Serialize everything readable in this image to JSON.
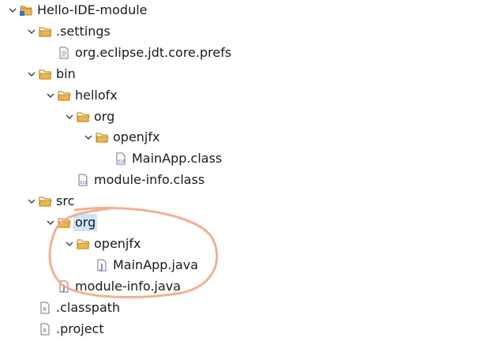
{
  "explorer": {
    "items": [
      {
        "label": "Hello-IDE-module",
        "icon": "project-icon",
        "depth": 0,
        "expanded": true
      },
      {
        "label": ".settings",
        "icon": "folder-icon",
        "depth": 1,
        "expanded": true
      },
      {
        "label": "org.eclipse.jdt.core.prefs",
        "icon": "file-icon",
        "depth": 2
      },
      {
        "label": "bin",
        "icon": "folder-icon",
        "depth": 1,
        "expanded": true
      },
      {
        "label": "hellofx",
        "icon": "folder-icon",
        "depth": 2,
        "expanded": true
      },
      {
        "label": "org",
        "icon": "folder-icon",
        "depth": 3,
        "expanded": true
      },
      {
        "label": "openjfx",
        "icon": "folder-icon",
        "depth": 4,
        "expanded": true
      },
      {
        "label": "MainApp.class",
        "icon": "class-file-icon",
        "depth": 5
      },
      {
        "label": "module-info.class",
        "icon": "class-file-icon",
        "depth": 3
      },
      {
        "label": "src",
        "icon": "folder-icon",
        "depth": 1,
        "expanded": true
      },
      {
        "label": "org",
        "icon": "folder-icon",
        "depth": 2,
        "expanded": true,
        "selected": true
      },
      {
        "label": "openjfx",
        "icon": "folder-icon",
        "depth": 3,
        "expanded": true
      },
      {
        "label": "MainApp.java",
        "icon": "java-file-icon",
        "depth": 4
      },
      {
        "label": "module-info.java",
        "icon": "java-file-icon",
        "depth": 2
      },
      {
        "label": ".classpath",
        "icon": "xml-file-icon",
        "depth": 1
      },
      {
        "label": ".project",
        "icon": "xml-file-icon",
        "depth": 1
      }
    ]
  },
  "colors": {
    "folder": "#e8b64c",
    "selection": "#cfe4f7",
    "annotation": "#f2a785"
  }
}
